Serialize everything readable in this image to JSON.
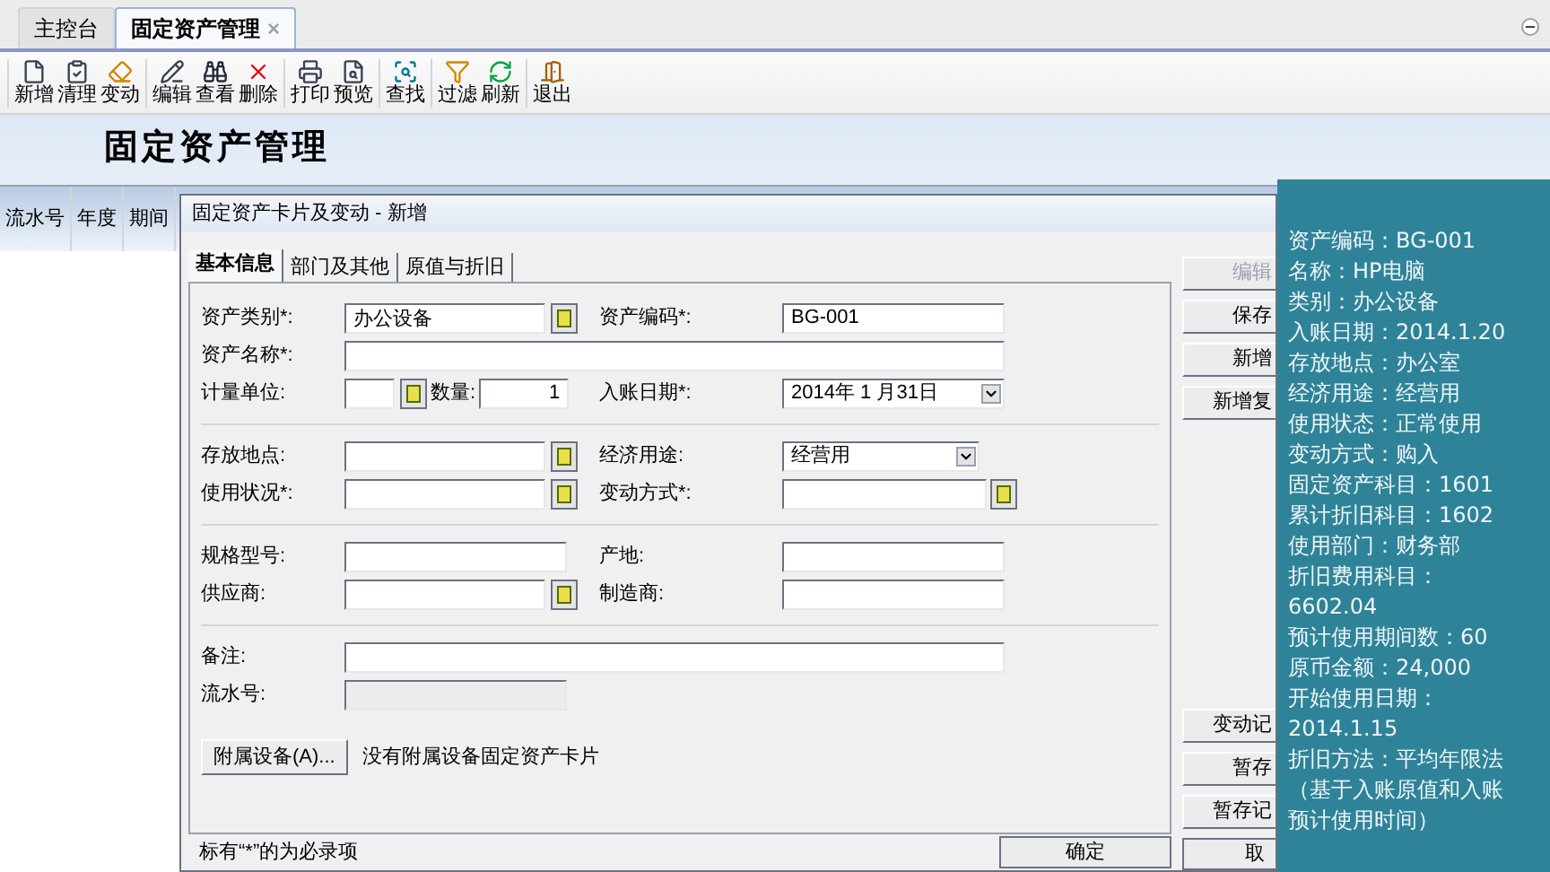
{
  "tabs": [
    {
      "label": "主控台",
      "selected": false
    },
    {
      "label": "固定资产管理",
      "selected": true,
      "close": "×"
    }
  ],
  "toolbar": [
    [
      {
        "label": "新增"
      },
      {
        "label": "清理"
      },
      {
        "label": "变动"
      }
    ],
    [
      {
        "label": "编辑"
      },
      {
        "label": "查看"
      },
      {
        "label": "删除"
      }
    ],
    [
      {
        "label": "打印"
      },
      {
        "label": "预览"
      }
    ],
    [
      {
        "label": "查找"
      }
    ],
    [
      {
        "label": "过滤"
      },
      {
        "label": "刷新"
      }
    ],
    [
      {
        "label": "退出"
      }
    ]
  ],
  "banner": {
    "title": "固定资产管理"
  },
  "table": {
    "columns": [
      "流水号",
      "年度",
      "期间"
    ]
  },
  "dialog": {
    "title": "固定资产卡片及变动 - 新增",
    "tabs": [
      {
        "label": "基本信息",
        "selected": true
      },
      {
        "label": "部门及其他",
        "selected": false
      },
      {
        "label": "原值与折旧",
        "selected": false
      }
    ],
    "sections": [
      [
        {
          "left": [
            {
              "label": "资产类别*:",
              "kind": "lookup",
              "value": "办公设备"
            }
          ],
          "right": [
            {
              "label": "资产编码*:",
              "kind": "text",
              "value": "BG-001"
            }
          ]
        },
        {
          "full": {
            "label": "资产名称*:",
            "kind": "wide"
          }
        },
        {
          "left": [
            {
              "label": "计量单位:",
              "kind": "unit"
            },
            {
              "label": "数量:",
              "kind": "number",
              "value": "1"
            }
          ],
          "right": [
            {
              "label": "入账日期*:",
              "kind": "date",
              "value": "2014年 1 月31日"
            }
          ]
        }
      ],
      [
        {
          "left": [
            {
              "label": "存放地点:",
              "kind": "lookup"
            }
          ],
          "right": [
            {
              "label": "经济用途:",
              "kind": "select",
              "value": "经营用"
            }
          ]
        },
        {
          "left": [
            {
              "label": "使用状况*:",
              "kind": "lookup"
            }
          ],
          "right": [
            {
              "label": "变动方式*:",
              "kind": "lookup_wide"
            }
          ]
        }
      ],
      [
        {
          "left": [
            {
              "label": "规格型号:",
              "kind": "text"
            }
          ],
          "right": [
            {
              "label": "产地:",
              "kind": "text"
            }
          ]
        },
        {
          "left": [
            {
              "label": "供应商:",
              "kind": "lookup"
            }
          ],
          "right": [
            {
              "label": "制造商:",
              "kind": "text"
            }
          ]
        }
      ],
      [
        {
          "full": {
            "label": "备注:",
            "kind": "wide"
          }
        },
        {
          "full": {
            "label": "流水号:",
            "kind": "readonly"
          }
        }
      ]
    ],
    "attach_button": "附属设备(A)...",
    "attach_note": "没有附属设备固定资产卡片",
    "side_buttons_top": [
      {
        "label": "编辑",
        "disabled": true
      },
      {
        "label": "保存",
        "disabled": false
      },
      {
        "label": "新增",
        "disabled": false
      },
      {
        "label": "新增复",
        "disabled": false
      }
    ],
    "side_buttons_bottom": [
      {
        "label": "变动记",
        "disabled": false
      },
      {
        "label": "暂存",
        "disabled": false
      },
      {
        "label": "暂存记",
        "disabled": false
      }
    ],
    "footer_note": "标有“*”的为必录项",
    "ok_button": "确定",
    "cancel_button": "取"
  },
  "info_panel": {
    "lines": [
      "资产编码：BG-001",
      "名称：HP电脑",
      "类别：办公设备",
      "入账日期：2014.1.20",
      "存放地点：办公室",
      "经济用途：经营用",
      "使用状态：正常使用",
      "变动方式：购入",
      "固定资产科目：1601",
      "累计折旧科目：1602",
      "使用部门：财务部",
      "折旧费用科目：",
      "6602.04",
      "预计使用期间数：60",
      "原币金额：24,000",
      "开始使用日期：",
      "2014.1.15",
      "折旧方法：平均年限法",
      "（基于入账原值和入账",
      "预计使用时间）"
    ]
  }
}
